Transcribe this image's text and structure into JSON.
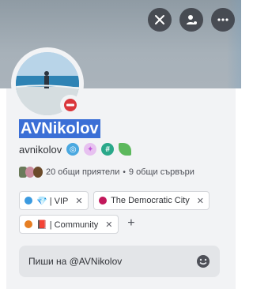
{
  "profile": {
    "display_name": "AVNikolov",
    "username": "avnikolov",
    "status": "do-not-disturb",
    "banner_color": "#a7b1b9"
  },
  "actions": {
    "items": [
      {
        "name": "block-icon",
        "label": ""
      },
      {
        "name": "user-settings-icon",
        "label": ""
      },
      {
        "name": "more-icon",
        "label": ""
      }
    ]
  },
  "badges": [
    {
      "name": "nitro-badge-icon",
      "color": "#4aa8e0"
    },
    {
      "name": "boost-badge-icon",
      "color": "#c056d8"
    },
    {
      "name": "hashtag-badge-icon",
      "color": "#2aa88a"
    },
    {
      "name": "leaf-badge-icon",
      "color": "#5cb85c"
    }
  ],
  "mutuals": {
    "friends_text": "20 общи приятели",
    "servers_text": "9 общи сървъри"
  },
  "roles": [
    {
      "label": "💎 | VIP",
      "color": "#3b9ae0"
    },
    {
      "label": "The Democratic City",
      "color": "#c2185b"
    },
    {
      "label": "📕 | Community",
      "color": "#e67e22"
    }
  ],
  "message": {
    "placeholder": "Пиши на @AVNikolov"
  }
}
